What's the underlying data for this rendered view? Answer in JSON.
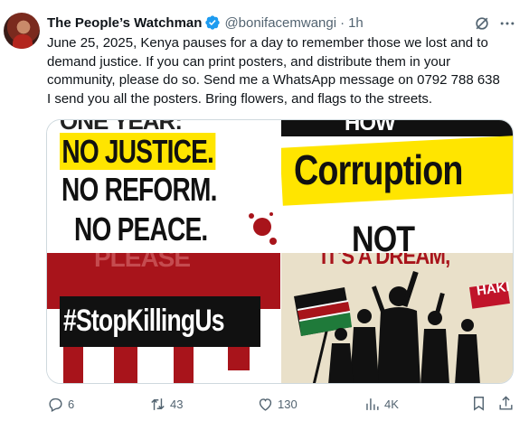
{
  "author": {
    "name": "The People’s Watchman",
    "handle": "@bonifacemwangi",
    "separator": "·",
    "time": "1h"
  },
  "tweet": {
    "lines": [
      "June 25, 2025, Kenya pauses for a day to remember those we lost and to",
      "demand justice. If you can print posters, and distribute them in your",
      "community, please do so. Send me a WhatsApp message on 0792 788 638",
      "I send you all the posters. Bring flowers, and flags to the streets."
    ]
  },
  "media": {
    "poster1": {
      "top": "ONE YEAR:",
      "l1": "NO JUSTICE.",
      "l2": "NO REFORM.",
      "l3": "NO PEACE."
    },
    "poster2": {
      "top": "HOW",
      "l1": "Corruption",
      "l2": "NOT"
    },
    "poster3": {
      "top": "PLEASE",
      "l1": "#StopKillingUs"
    },
    "poster4": {
      "top": "IT'S A DREAM,",
      "sign": "HAKI"
    }
  },
  "actions": {
    "replies": "6",
    "reposts": "43",
    "likes": "130",
    "views": "4K"
  },
  "colors": {
    "accent": "#1d9bf0",
    "muted": "#536471",
    "poster_yellow": "#ffe500",
    "blood_red": "#a8141b"
  }
}
